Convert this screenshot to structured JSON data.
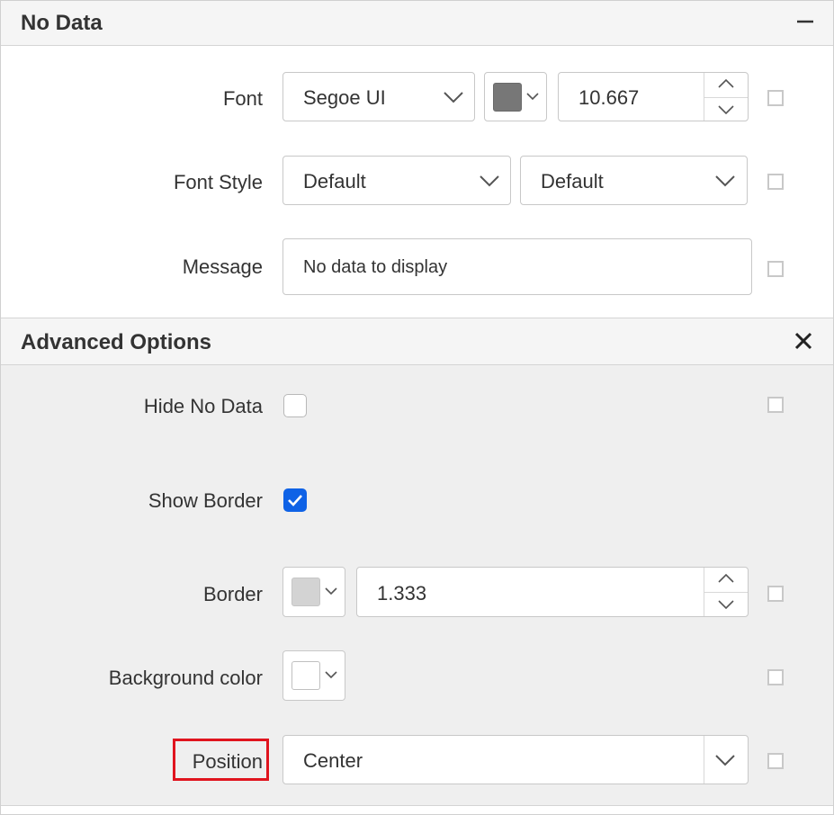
{
  "no_data": {
    "title": "No Data",
    "collapse_icon": "minus-icon",
    "font_label": "Font",
    "font_family": "Segoe UI",
    "font_color": "#777777",
    "font_size": "10.667",
    "font_style_label": "Font Style",
    "font_style": "Default",
    "font_weight": "Default",
    "message_label": "Message",
    "message_value": "No data to display"
  },
  "advanced": {
    "title": "Advanced Options",
    "close_icon": "close-icon",
    "hide_no_data_label": "Hide No Data",
    "hide_no_data_checked": false,
    "show_border_label": "Show Border",
    "show_border_checked": true,
    "border_label": "Border",
    "border_color": "#d3d3d3",
    "border_width": "1.333",
    "background_color_label": "Background color",
    "background_color": "#ffffff",
    "position_label": "Position",
    "position_value": "Center"
  }
}
